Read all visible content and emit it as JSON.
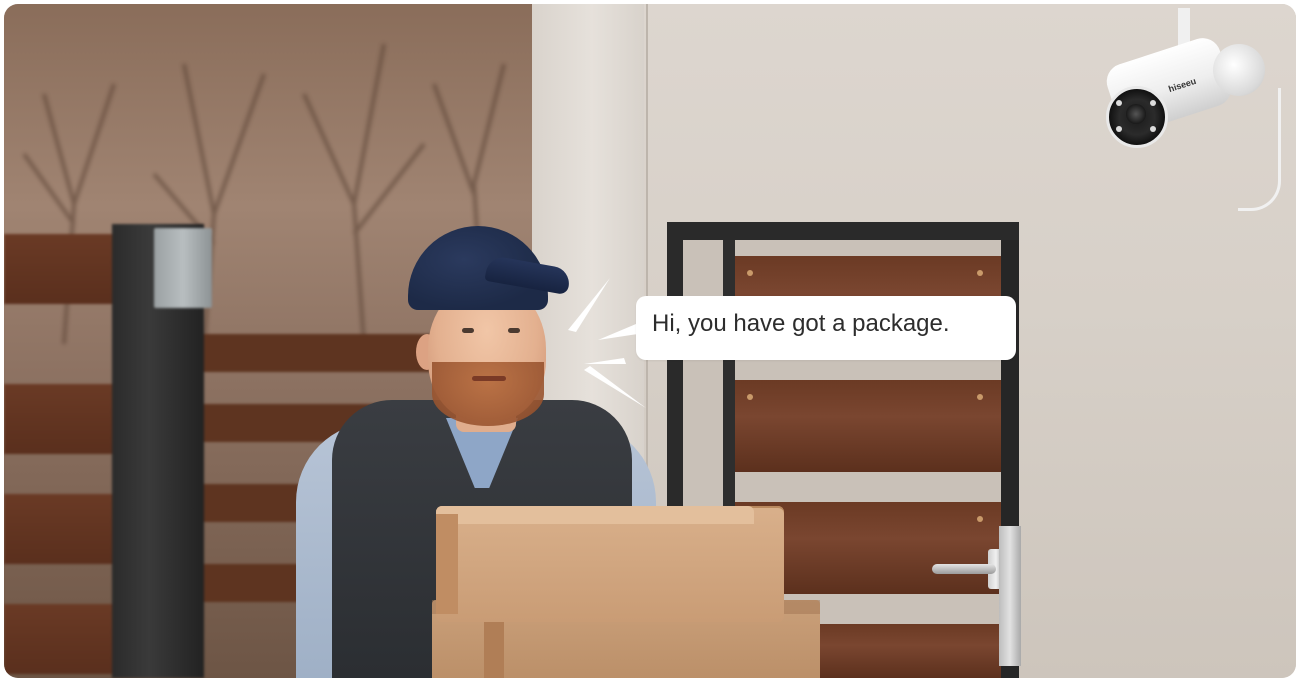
{
  "speech_bubble": {
    "text": "Hi, you have got a package."
  },
  "camera": {
    "brand_logo": "hiseeu"
  },
  "colors": {
    "bubble_background": "#ffffff",
    "bubble_text": "#2d2d2d",
    "cap": "#1d2a47",
    "vest": "#2b2e32",
    "box": "#c99c75"
  }
}
